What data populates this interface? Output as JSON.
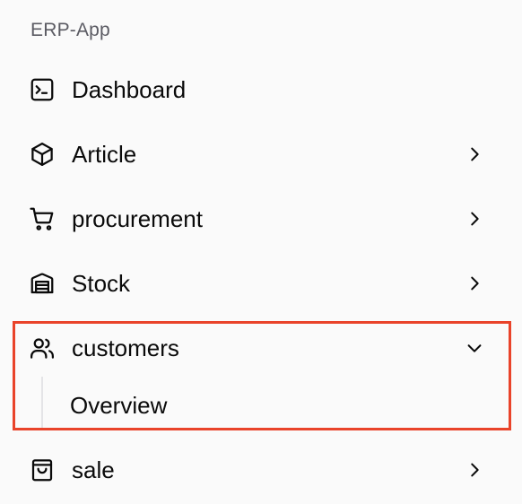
{
  "sidebar": {
    "group_label": "ERP-App",
    "items": [
      {
        "label": "Dashboard",
        "icon": "terminal-square-icon"
      },
      {
        "label": "Article",
        "icon": "package-icon"
      },
      {
        "label": "procurement",
        "icon": "shopping-cart-icon"
      },
      {
        "label": "Stock",
        "icon": "warehouse-icon"
      },
      {
        "label": "customers",
        "icon": "users-icon",
        "expanded": true,
        "children": [
          {
            "label": "Overview"
          }
        ]
      },
      {
        "label": "sale",
        "icon": "shopping-bag-icon"
      }
    ],
    "highlight_color": "#e9432a"
  }
}
